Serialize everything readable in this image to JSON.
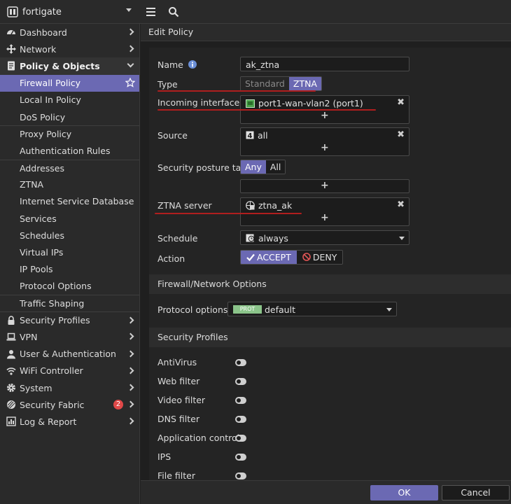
{
  "device": {
    "name": "fortigate"
  },
  "sidebar": {
    "items": [
      {
        "label": "Dashboard"
      },
      {
        "label": "Network"
      },
      {
        "label": "Policy & Objects"
      },
      {
        "label": "Firewall Policy"
      },
      {
        "label": "Local In Policy"
      },
      {
        "label": "DoS Policy"
      },
      {
        "label": "Proxy Policy"
      },
      {
        "label": "Authentication Rules"
      },
      {
        "label": "Addresses"
      },
      {
        "label": "ZTNA"
      },
      {
        "label": "Internet Service Database"
      },
      {
        "label": "Services"
      },
      {
        "label": "Schedules"
      },
      {
        "label": "Virtual IPs"
      },
      {
        "label": "IP Pools"
      },
      {
        "label": "Protocol Options"
      },
      {
        "label": "Traffic Shaping"
      },
      {
        "label": "Security Profiles"
      },
      {
        "label": "VPN"
      },
      {
        "label": "User & Authentication"
      },
      {
        "label": "WiFi Controller"
      },
      {
        "label": "System"
      },
      {
        "label": "Security Fabric",
        "badge": "2"
      },
      {
        "label": "Log & Report"
      }
    ]
  },
  "page": {
    "title": "Edit Policy"
  },
  "form": {
    "name_label": "Name",
    "name_value": "ak_ztna",
    "type_label": "Type",
    "type_options": [
      "Standard",
      "ZTNA"
    ],
    "type_selected": "ZTNA",
    "incoming_label": "Incoming interface",
    "incoming_value": "port1-wan-vlan2 (port1)",
    "source_label": "Source",
    "source_value": "all",
    "posture_label": "Security posture tag",
    "posture_options": [
      "Any",
      "All"
    ],
    "ztna_label": "ZTNA server",
    "ztna_value": "ztna_ak",
    "schedule_label": "Schedule",
    "schedule_value": "always",
    "action_label": "Action",
    "action_accept": "ACCEPT",
    "action_deny": "DENY",
    "plus": "+",
    "remove": "✖"
  },
  "fw_options": {
    "title": "Firewall/Network Options",
    "protocol_label": "Protocol options",
    "protocol_tag": "PROT",
    "protocol_value": "default"
  },
  "security_profiles": {
    "title": "Security Profiles",
    "items": [
      "AntiVirus",
      "Web filter",
      "Video filter",
      "DNS filter",
      "Application control",
      "IPS",
      "File filter"
    ]
  },
  "footer": {
    "ok": "OK",
    "cancel": "Cancel"
  },
  "colors": {
    "accent": "#6b69b3",
    "annotation": "#b01e1e",
    "badge": "#e04848",
    "prot_tag": "#8bc48a"
  }
}
